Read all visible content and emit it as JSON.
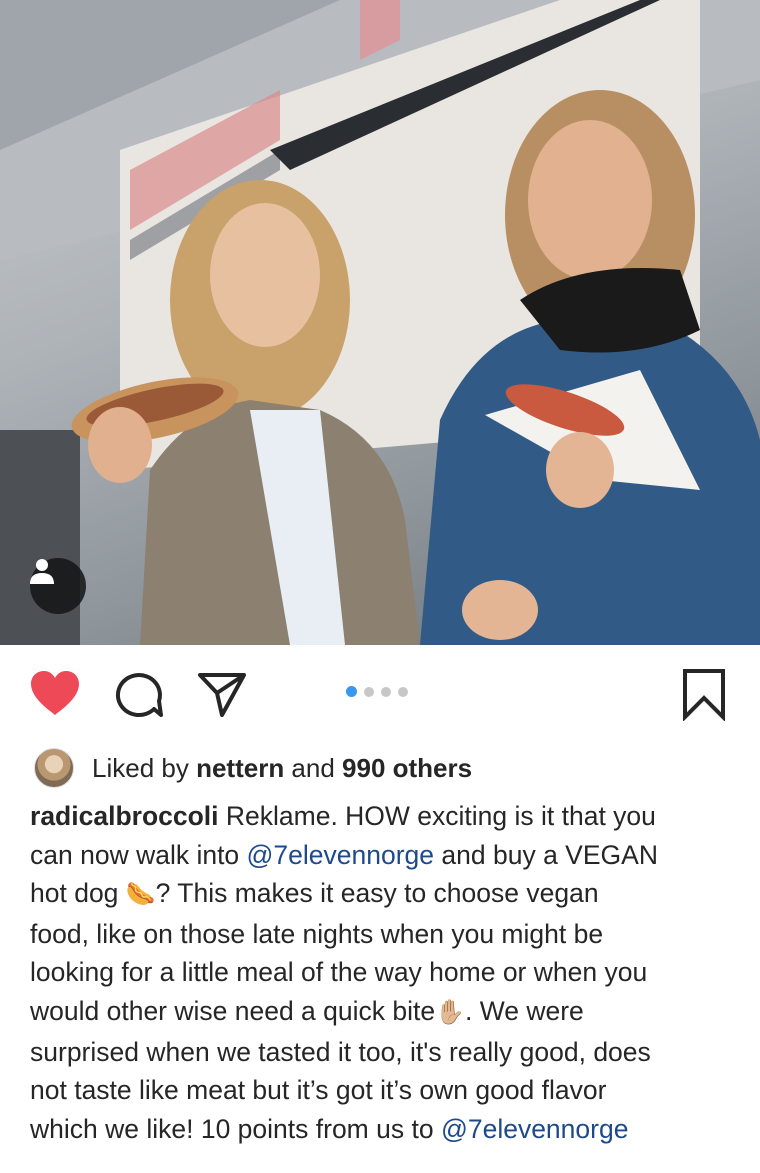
{
  "post": {
    "photo_alt": "Two women holding hot dogs in front of a 7-Eleven store",
    "user_tag_icon": "person-icon",
    "actions": {
      "like_icon": "heart-filled-icon",
      "comment_icon": "comment-icon",
      "share_icon": "paper-plane-icon",
      "save_icon": "bookmark-icon",
      "like_color": "#ed4956"
    },
    "carousel": {
      "count": 4,
      "active": 1,
      "active_color": "#3897f0"
    },
    "likes": {
      "prefix": "Liked by ",
      "user": "nettern",
      "middle": " and ",
      "count": "990 others"
    },
    "caption": {
      "username": "radicalbroccoli",
      "line1": " Reklame. HOW exciting is it that you",
      "line2_a": "can now walk into ",
      "mention1": "@7elevennorge",
      "line2_b": " and buy a VEGAN",
      "line3_a": "hot dog ",
      "hotdog_emoji": "🌭",
      "line3_b": "? This makes it easy to choose vegan",
      "line4": "food, like on those late nights when you might be",
      "line5": "looking for a little meal of the way home or when you",
      "line6_a": "would other wise need a quick bite",
      "hand_emoji": "✋🏼",
      "line6_b": ". We were",
      "line7": "surprised when we tasted it too, it's really good, does",
      "line8": "not taste like meat but it’s got it’s own good flavor",
      "line9_a": "which we like! 10 points from us to ",
      "mention2": "@7elevennorge"
    }
  }
}
